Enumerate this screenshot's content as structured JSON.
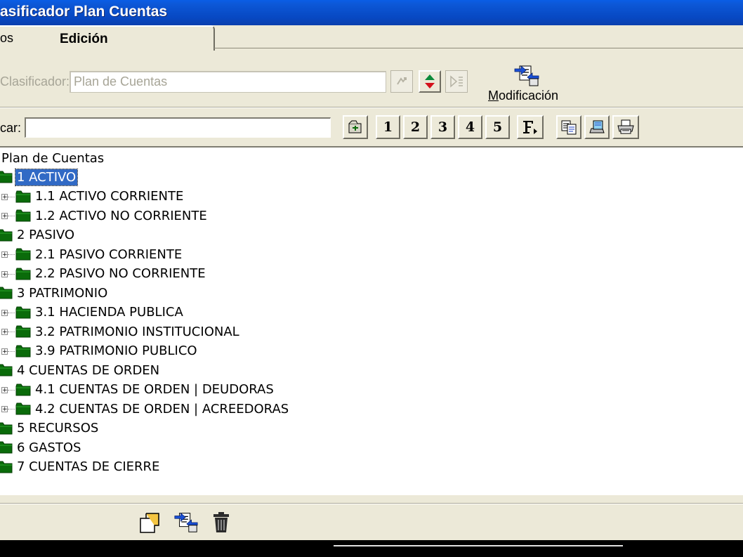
{
  "window": {
    "title": "asificador Plan Cuentas"
  },
  "tabs": [
    {
      "label": "os"
    },
    {
      "label": "Edición"
    }
  ],
  "classifier": {
    "label": "Clasificador:",
    "value": "Plan de Cuentas",
    "modify_button": {
      "label_first": "M",
      "label_rest": "odificación"
    }
  },
  "search": {
    "label": "car:",
    "value": "",
    "level_buttons": [
      "1",
      "2",
      "3",
      "4",
      "5"
    ]
  },
  "tree": {
    "root": "Plan de Cuentas",
    "nodes": [
      {
        "text": "1 ACTIVO",
        "level": 0,
        "selected": true
      },
      {
        "text": "1.1 ACTIVO CORRIENTE",
        "level": 1,
        "expandable": true
      },
      {
        "text": "1.2 ACTIVO NO CORRIENTE",
        "level": 1,
        "expandable": true
      },
      {
        "text": "2 PASIVO",
        "level": 0
      },
      {
        "text": "2.1 PASIVO CORRIENTE",
        "level": 1,
        "expandable": true
      },
      {
        "text": "2.2 PASIVO NO CORRIENTE",
        "level": 1,
        "expandable": true
      },
      {
        "text": "3 PATRIMONIO",
        "level": 0
      },
      {
        "text": "3.1 HACIENDA PUBLICA",
        "level": 1,
        "expandable": true
      },
      {
        "text": "3.2 PATRIMONIO INSTITUCIONAL",
        "level": 1,
        "expandable": true
      },
      {
        "text": "3.9 PATRIMONIO PUBLICO",
        "level": 1,
        "expandable": true
      },
      {
        "text": "4 CUENTAS DE ORDEN",
        "level": 0
      },
      {
        "text": "4.1 CUENTAS DE ORDEN | DEUDORAS",
        "level": 1,
        "expandable": true
      },
      {
        "text": "4.2 CUENTAS DE ORDEN | ACREEDORAS",
        "level": 1,
        "expandable": true
      },
      {
        "text": "5 RECURSOS",
        "level": 0
      },
      {
        "text": "6 GASTOS",
        "level": 0
      },
      {
        "text": "7 CUENTAS DE CIERRE",
        "level": 0
      }
    ]
  },
  "colors": {
    "titlebar": "#0748c2",
    "selection": "#316ac5",
    "folder": "#0a6b0a"
  }
}
